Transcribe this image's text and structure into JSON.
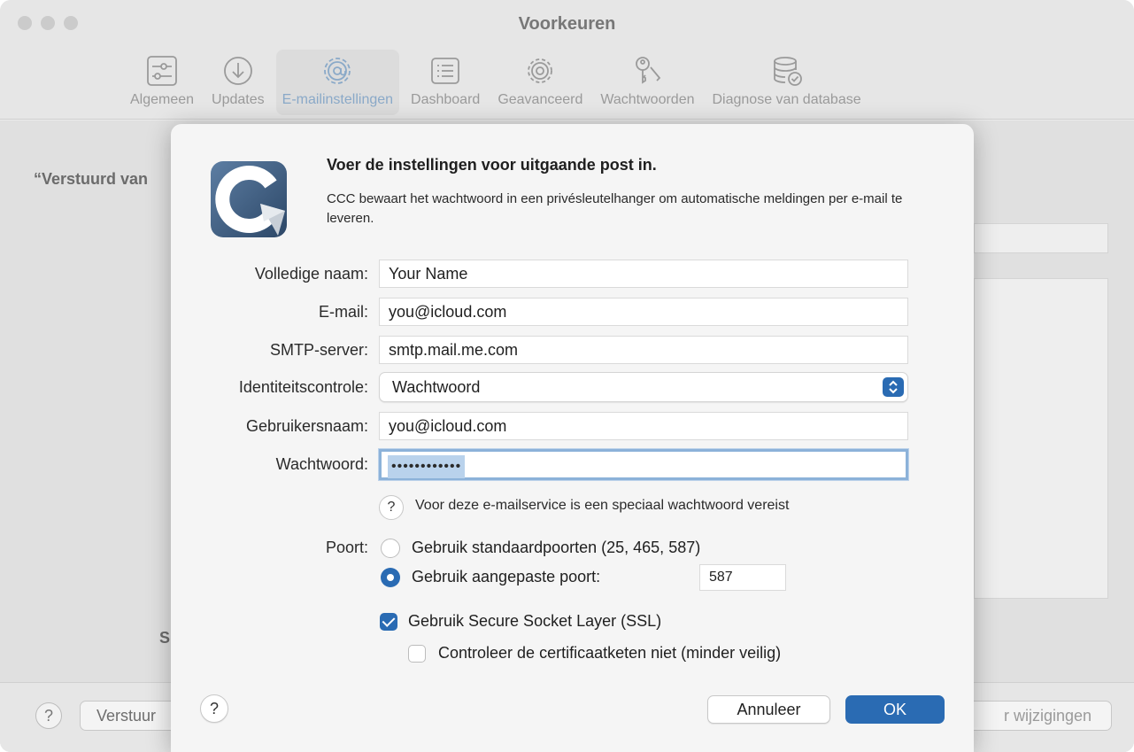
{
  "window": {
    "title": "Voorkeuren"
  },
  "toolbar": {
    "items": [
      {
        "label": "Algemeen",
        "icon": "sliders-icon"
      },
      {
        "label": "Updates",
        "icon": "download-icon"
      },
      {
        "label": "E-mailinstellingen",
        "icon": "at-gear-icon",
        "active": true
      },
      {
        "label": "Dashboard",
        "icon": "list-icon"
      },
      {
        "label": "Geavanceerd",
        "icon": "gear-icon"
      },
      {
        "label": "Wachtwoorden",
        "icon": "keys-icon"
      },
      {
        "label": "Diagnose van database",
        "icon": "database-check-icon"
      }
    ]
  },
  "background": {
    "heading": "“Verstuurd van",
    "s_label": "S",
    "help_label": "?",
    "left_button": "Verstuur",
    "right_button": "r wijzigingen"
  },
  "sheet": {
    "title": "Voer de instellingen voor uitgaande post in.",
    "description": "CCC bewaart het wachtwoord in een privésleutelhanger om automatische meldingen per e-mail te leveren.",
    "fields": {
      "full_name": {
        "label": "Volledige naam:",
        "value": "Your Name"
      },
      "email": {
        "label": "E-mail:",
        "value": "you@icloud.com"
      },
      "smtp": {
        "label": "SMTP-server:",
        "value": "smtp.mail.me.com"
      },
      "auth": {
        "label": "Identiteitscontrole:",
        "value": "Wachtwoord"
      },
      "username": {
        "label": "Gebruikersnaam:",
        "value": "you@icloud.com"
      },
      "password": {
        "label": "Wachtwoord:",
        "value": "••••••••••••"
      }
    },
    "password_help": {
      "icon": "?",
      "text": "Voor deze e-mailservice is een speciaal wachtwoord vereist"
    },
    "port": {
      "label": "Poort:",
      "option_standard": "Gebruik standaardpoorten (25, 465, 587)",
      "option_custom": "Gebruik aangepaste poort:",
      "selected": "custom",
      "custom_value": "587"
    },
    "ssl": {
      "label": "Gebruik Secure Socket Layer (SSL)",
      "checked": true
    },
    "no_verify": {
      "label": "Controleer de certificaatketen niet (minder veilig)",
      "checked": false
    },
    "help_label": "?",
    "buttons": {
      "cancel": "Annuleer",
      "ok": "OK"
    }
  },
  "colors": {
    "accent": "#2a6bb3",
    "focus_ring": "#8cb2d9",
    "selection": "#b9d2ec"
  }
}
